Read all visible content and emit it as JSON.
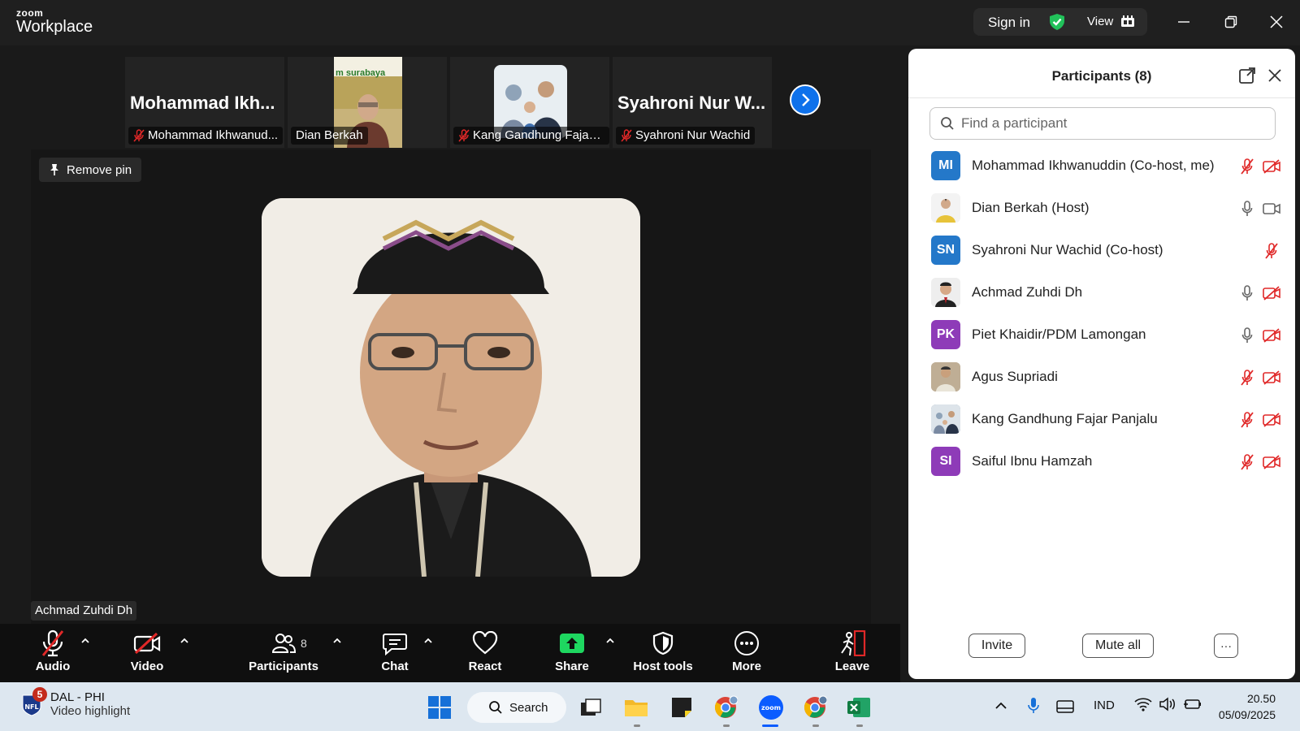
{
  "app": {
    "logo_top": "zoom",
    "logo_bottom": "Workplace",
    "sign_in": "Sign in",
    "view": "View"
  },
  "thumbnails": [
    {
      "big_name": "Mohammad  Ikh...",
      "label": "Mohammad Ikhwanud...",
      "muted": true
    },
    {
      "big_name": "",
      "label": "Dian Berkah",
      "muted": false,
      "photo_caption": "m surabaya"
    },
    {
      "big_name": "",
      "label": "Kang Gandhung Fajar ...",
      "muted": true
    },
    {
      "big_name": "Syahroni  Nur  W...",
      "label": "Syahroni Nur Wachid",
      "muted": true
    }
  ],
  "main_video": {
    "remove_pin": "Remove pin",
    "speaker": "Achmad Zuhdi Dh"
  },
  "toolbar": {
    "audio": "Audio",
    "video": "Video",
    "participants": "Participants",
    "participants_count": "8",
    "chat": "Chat",
    "react": "React",
    "share": "Share",
    "host_tools": "Host tools",
    "more": "More",
    "leave": "Leave"
  },
  "panel": {
    "title": "Participants (8)",
    "search_placeholder": "Find a participant",
    "participants": [
      {
        "initials": "MI",
        "name": "Mohammad Ikhwanuddin (Co-host, me)",
        "avatar_color": "#2478c9",
        "mic": "muted",
        "cam": "off"
      },
      {
        "initials": "",
        "name": "Dian Berkah (Host)",
        "avatar_color": "#f3f3f3",
        "mic": "on",
        "cam": "on"
      },
      {
        "initials": "SN",
        "name": "Syahroni Nur Wachid (Co-host)",
        "avatar_color": "#2478c9",
        "mic": "muted",
        "cam": "none"
      },
      {
        "initials": "",
        "name": "Achmad Zuhdi Dh",
        "avatar_color": "#eeeeee",
        "mic": "on",
        "cam": "off"
      },
      {
        "initials": "PK",
        "name": "Piet Khaidir/PDM Lamongan",
        "avatar_color": "#8e3bb8",
        "mic": "on",
        "cam": "off"
      },
      {
        "initials": "",
        "name": "Agus Supriadi",
        "avatar_color": "#bfae95",
        "mic": "muted",
        "cam": "off"
      },
      {
        "initials": "",
        "name": "Kang Gandhung Fajar Panjalu",
        "avatar_color": "#6a7da0",
        "mic": "muted",
        "cam": "off"
      },
      {
        "initials": "SI",
        "name": "Saiful Ibnu Hamzah",
        "avatar_color": "#8e3bb8",
        "mic": "muted",
        "cam": "off"
      }
    ],
    "invite": "Invite",
    "mute_all": "Mute all",
    "more": "···"
  },
  "taskbar": {
    "widget_badge": "5",
    "widget_title": "DAL - PHI",
    "widget_subtitle": "Video highlight",
    "search": "Search",
    "language": "IND",
    "time": "20.50",
    "date": "05/09/2025"
  },
  "colors": {
    "accent_blue": "#0e71eb",
    "muted_red": "#e02828",
    "share_green": "#1ed760"
  }
}
